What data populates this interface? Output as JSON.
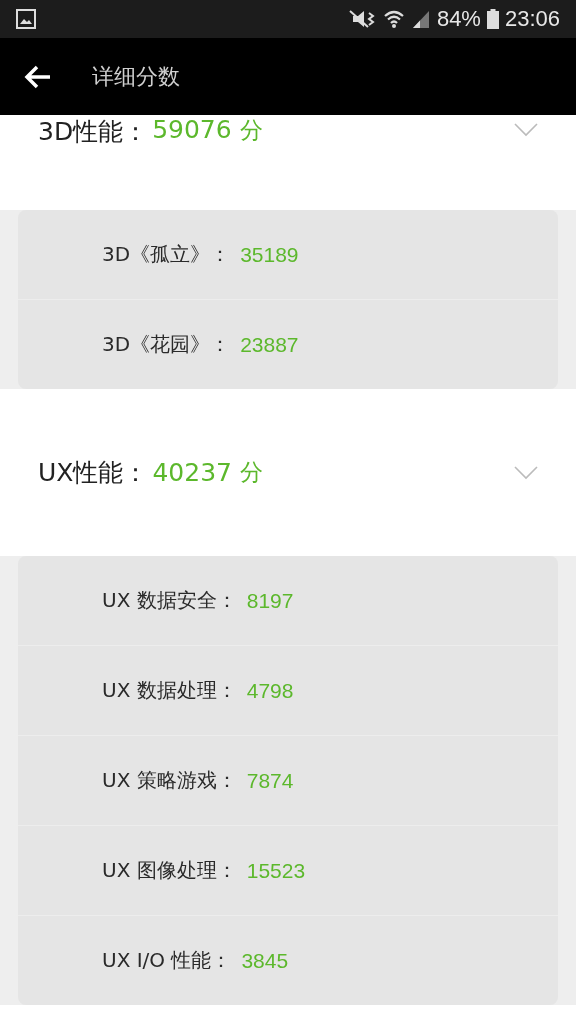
{
  "status_bar": {
    "battery": "84%",
    "time": "23:06"
  },
  "app_bar": {
    "title": "详细分数"
  },
  "sections": [
    {
      "label": "3D性能：",
      "score": "59076",
      "unit": "分",
      "expanded": true,
      "items": [
        {
          "label": "3D《孤立》：",
          "value": "35189"
        },
        {
          "label": "3D《花园》：",
          "value": "23887"
        }
      ]
    },
    {
      "label": "UX性能：",
      "score": "40237",
      "unit": "分",
      "expanded": true,
      "items": [
        {
          "label": "UX 数据安全：",
          "value": "8197"
        },
        {
          "label": "UX 数据处理：",
          "value": "4798"
        },
        {
          "label": "UX 策略游戏：",
          "value": "7874"
        },
        {
          "label": "UX 图像处理：",
          "value": "15523"
        },
        {
          "label": "UX I/O 性能：",
          "value": "3845"
        }
      ]
    }
  ]
}
